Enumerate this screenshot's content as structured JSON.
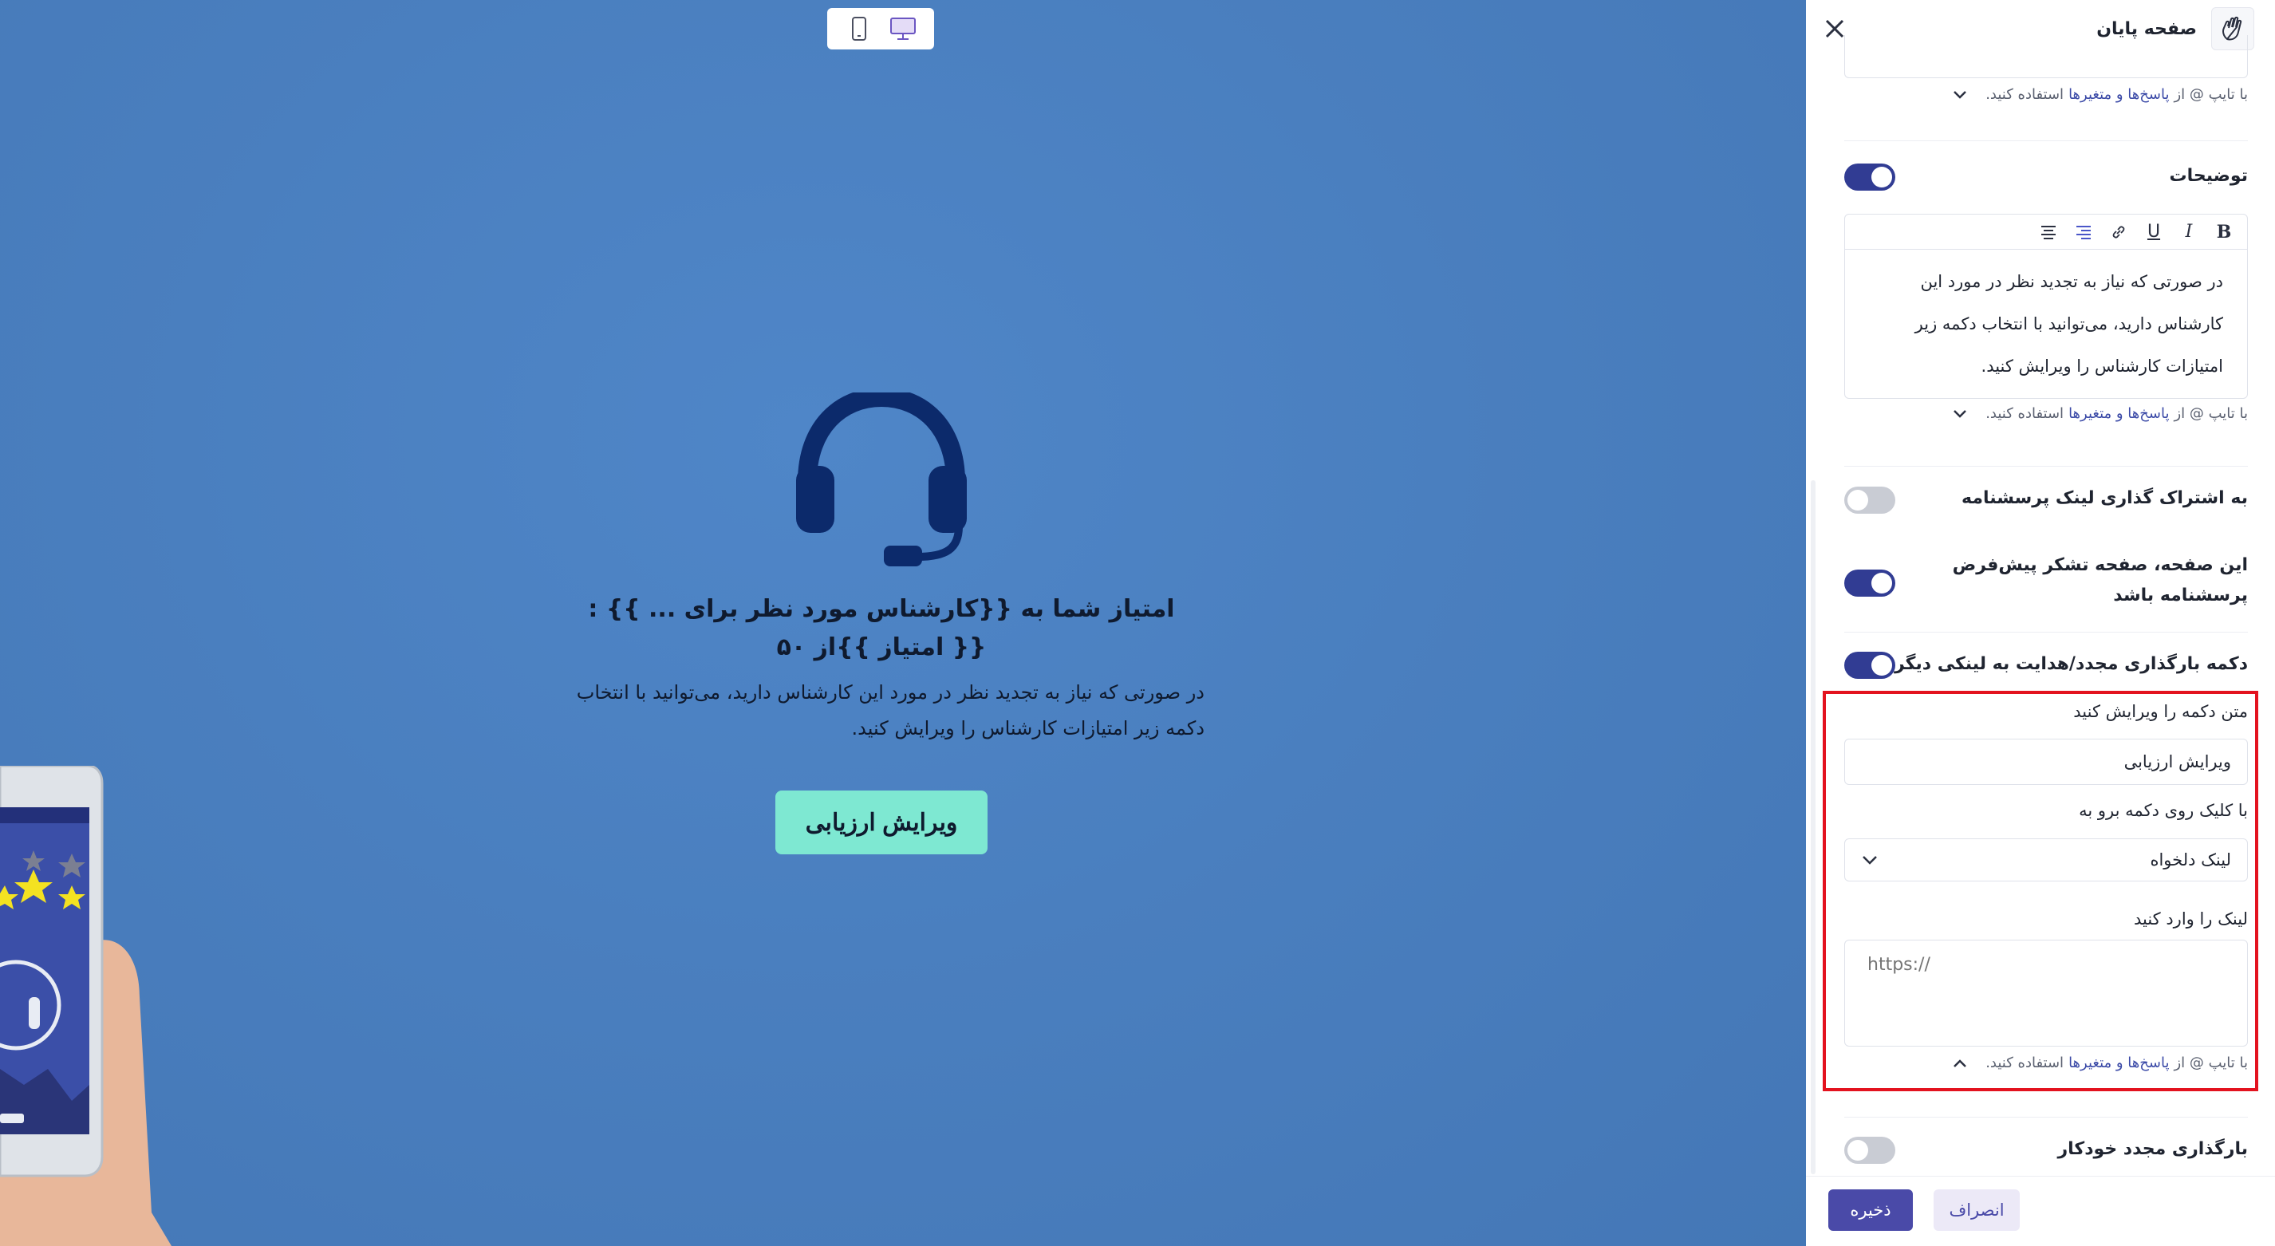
{
  "preview": {
    "title_line1": "امتیاز شما به {{کارشناس مورد نظر برای ... }} :",
    "title_line2": "{{ امتیاز }}از ۵۰",
    "description": "در صورتی که نیاز به تجدید نظر در مورد این کارشناس دارید، می‌توانید با انتخاب دکمه زیر امتیازات کارشناس را ویرایش کنید.",
    "button_label": "ویرایش ارزیابی",
    "device_toggle": {
      "mobile_icon": "mobile-icon",
      "desktop_icon": "desktop-icon",
      "active": "desktop"
    },
    "illustration_icon": "headset-icon"
  },
  "panel": {
    "title": "صفحه پایان",
    "header_icon": "waving-hand-icon",
    "close_icon": "close-icon",
    "hint": {
      "prefix": "با تایپ @ از",
      "vars": "پاسخ‌ها و متغیرها",
      "suffix": "استفاده کنید."
    },
    "description_section": {
      "label": "توضیحات",
      "enabled": true,
      "toolbar": [
        "B",
        "I",
        "U",
        "link",
        "align-right",
        "align-center"
      ],
      "text_line1": "در صورتی که نیاز به تجدید نظر در مورد این",
      "text_line2": "کارشناس دارید، می‌توانید با انتخاب دکمه زیر",
      "text_line3": "امتیازات کارشناس را ویرایش کنید."
    },
    "share_link": {
      "label": "به اشتراک گذاری لینک پرسشنامه",
      "enabled": false
    },
    "default_thanks": {
      "label_line1": "این صفحه، صفحه تشکر پیش‌فرض",
      "label_line2": "پرسشنامه باشد",
      "enabled": true
    },
    "reload_button": {
      "label": "دکمه بارگذاری مجدد/هدایت به لینکی دیگر",
      "enabled": true,
      "text_label": "متن دکمه را ویرایش کنید",
      "text_value": "ویرایش ارزیابی",
      "action_label": "با کلیک روی دکمه برو به",
      "action_value": "لینک دلخواه",
      "link_label": "لینک را وارد کنید",
      "link_placeholder": "https://"
    },
    "auto_reload": {
      "label": "بارگذاری مجدد خودکار",
      "enabled": false
    },
    "footer": {
      "save_label": "ذخیره",
      "cancel_label": "انصراف"
    },
    "colors": {
      "accent": "#313c93",
      "highlight": "#e3131f",
      "button_preview": "#7ee8d2"
    }
  }
}
